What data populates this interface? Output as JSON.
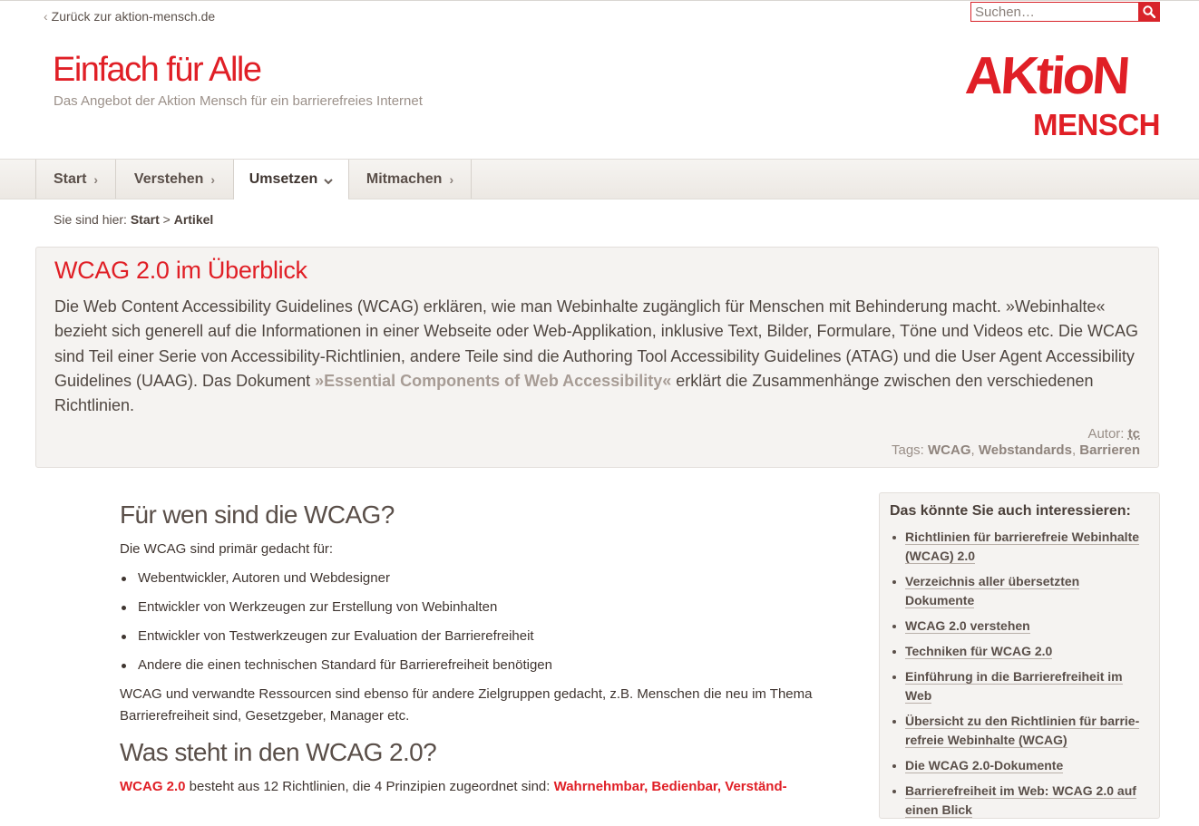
{
  "topbar": {
    "back_link": "Zurück zur aktion-mensch.de",
    "search_placeholder": "Suchen…"
  },
  "header": {
    "title": "Einfach für Alle",
    "subtitle": "Das Angebot der Aktion Mensch für ein barrierefreies Internet",
    "logo_line1": "AKtioN",
    "logo_line2": "MENSCH"
  },
  "nav": {
    "items": [
      {
        "label": "Start"
      },
      {
        "label": "Verstehen"
      },
      {
        "label": "Umsetzen"
      },
      {
        "label": "Mitmachen"
      }
    ],
    "active": "Umsetzen"
  },
  "breadcrumb": {
    "prefix": "Sie sind hier:",
    "start": "Start",
    "sep": ">",
    "current": "Artikel"
  },
  "intro": {
    "title": "WCAG 2.0 im Überblick",
    "text_1": "Die Web Content Accessibility Guidelines (WCAG) erklären, wie man Webinhalte zugänglich für Menschen mit Behinderung macht. »Webinhal­te« bezieht sich generell auf die Informationen in einer Webseite oder Web-Applikation, inklusive Text, Bilder, Formulare, Töne und Videos etc. Die WCAG sind Teil einer Serie von Accessibility-Richtlinien, andere Teile sind die Authoring Tool Accessibility Guidelines (ATAG) und die User Agent Accessibility Guidelines (UAAG). Das Dokument ",
    "link": "»Essential Components of Web Accessibility«",
    "text_2": " erklärt die Zusammenhänge zwischen den verschiedenen Richtlinien.",
    "author_label": "Autor:",
    "author": "tc",
    "tags_label": "Tags:",
    "tags": [
      "WCAG",
      "Webstandards",
      "Barrieren"
    ],
    "tag_sep": ","
  },
  "main": {
    "h2_1": "Für wen sind die WCAG?",
    "p_1": "Die WCAG sind primär gedacht für:",
    "list": [
      "Webentwickler, Autoren und Webdesigner",
      "Entwickler von Werkzeugen zur Erstellung von Webinhalten",
      "Entwickler von Testwerkzeugen zur Evaluation der Barrierefreiheit",
      "Andere die einen technischen Standard für Barrierefreiheit benötigen"
    ],
    "p_2": "WCAG und verwandte Ressourcen sind ebenso für andere Zielgruppen gedacht, z.B. Menschen die neu im Thema Barrierefreiheit sind, Gesetzgeber, Manager etc.",
    "h2_2": "Was steht in den WCAG 2.0?",
    "p_3_link": "WCAG 2.0",
    "p_3_text": " besteht aus 12 Richtlinien, die 4 Prinzipien zugeordnet sind: ",
    "p_3_link2": "Wahrnehmbar, Bedienbar, Verständ-"
  },
  "sidebar": {
    "title": "Das könnte Sie auch interessieren:",
    "links": [
      "Richtlinien für barrierefreie Webinhalte (WCAG) 2.0",
      "Verzeichnis aller übersetzten Dokumente",
      "WCAG 2.0 verstehen",
      "Techniken für WCAG 2.0",
      "Einführung in die Barrierefreiheit im Web",
      "Übersicht zu den Richtlinien für barrie­refreie Webinhalte (WCAG)",
      "Die WCAG 2.0-Dokumente",
      "Barrierefreiheit im Web: WCAG 2.0 auf einen Blick"
    ]
  },
  "colors": {
    "brand_red": "#e01f26",
    "text": "#4a3f39",
    "box_bg": "#f5f3f1"
  }
}
